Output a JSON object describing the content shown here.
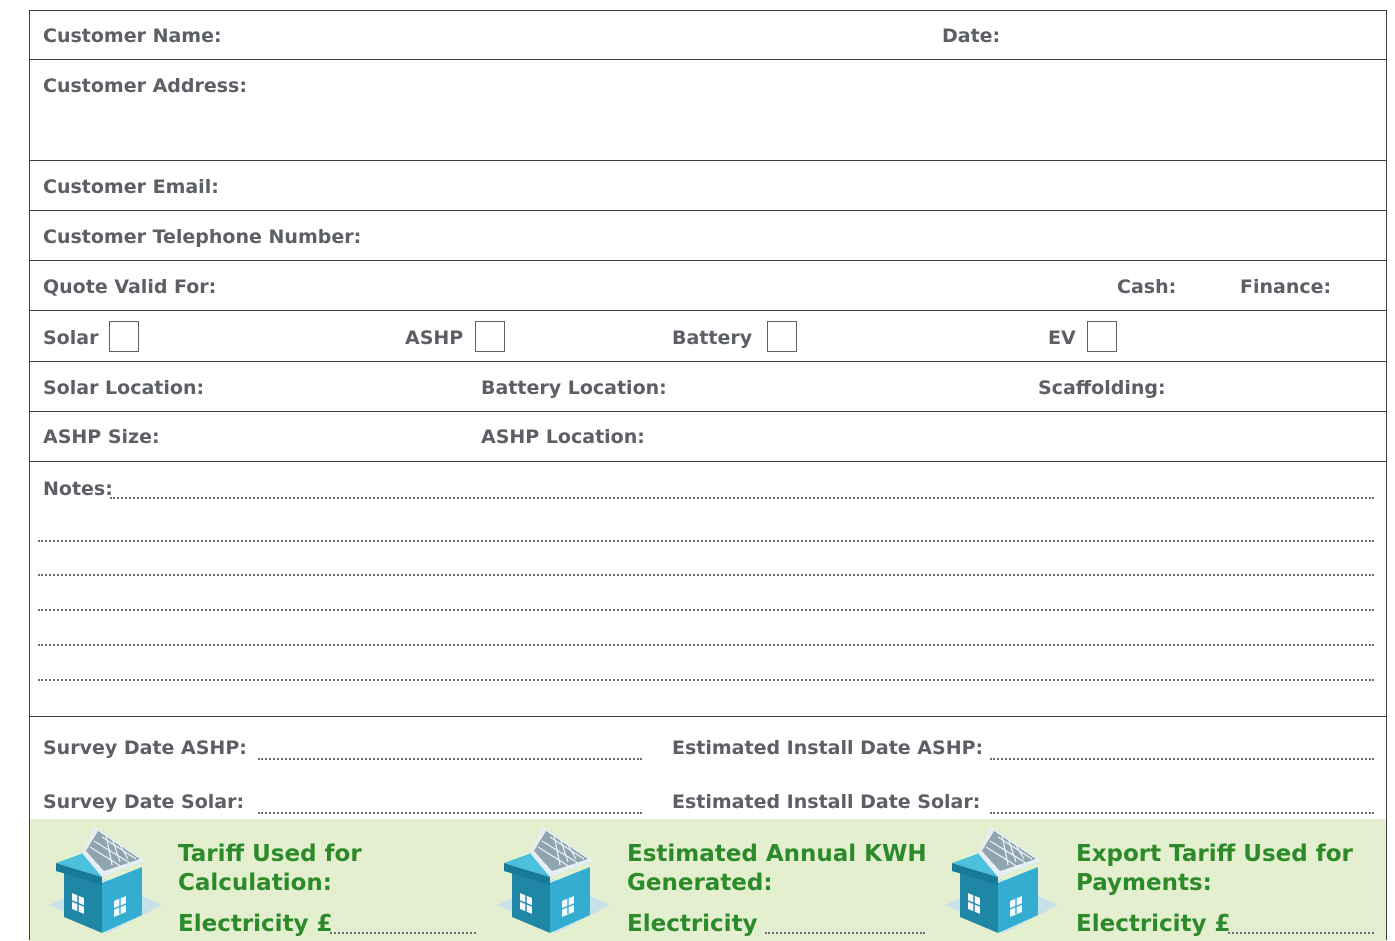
{
  "form": {
    "customer_name": "Customer Name:",
    "date": "Date:",
    "customer_address": "Customer Address:",
    "customer_email": "Customer Email:",
    "customer_telephone": "Customer Telephone Number:",
    "quote_valid_for": "Quote Valid For:",
    "cash": "Cash:",
    "finance": "Finance:",
    "products": {
      "solar": "Solar",
      "ashp": "ASHP",
      "battery": "Battery",
      "ev": "EV"
    },
    "solar_location": "Solar Location:",
    "battery_location": "Battery Location:",
    "scaffolding": "Scaffolding:",
    "ashp_size": "ASHP Size:",
    "ashp_location": "ASHP Location:",
    "notes": "Notes:",
    "survey_date_ashp": "Survey Date ASHP:",
    "est_install_ashp": "Estimated Install Date ASHP:",
    "survey_date_solar": "Survey Date Solar:",
    "est_install_solar": "Estimated Install Date Solar:"
  },
  "tariffs": {
    "panel1": {
      "title": "Tariff Used for\nCalculation:",
      "sub": "Electricity £"
    },
    "panel2": {
      "title": "Estimated Annual KWH\nGenerated:",
      "sub": "Electricity"
    },
    "panel3": {
      "title": "Export Tariff Used for\nPayments:",
      "sub": "Electricity £"
    }
  },
  "colors": {
    "border": "#3e3e3e",
    "label": "#5c6066",
    "green_text": "#2d8a2a",
    "green_bg": "#e3efcf",
    "house_teal": "#2fa3c4"
  }
}
